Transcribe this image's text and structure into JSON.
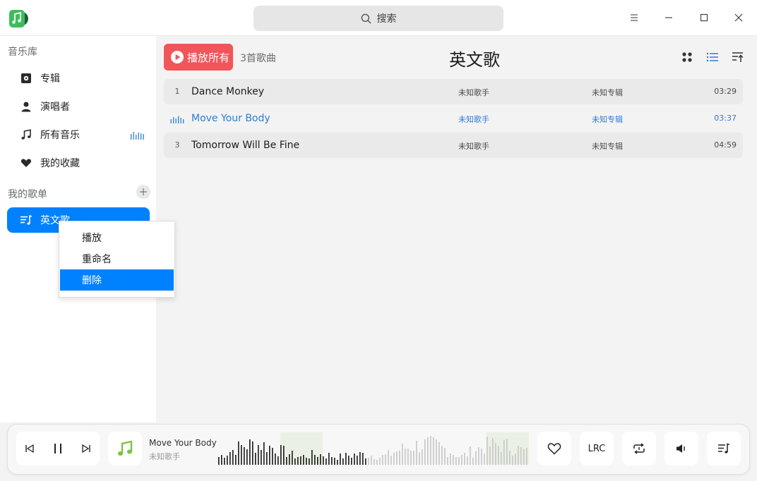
{
  "titlebar": {
    "search_label": "搜索"
  },
  "sidebar": {
    "library_title": "音乐库",
    "items": [
      {
        "label": "专辑",
        "icon": "album-icon"
      },
      {
        "label": "演唱者",
        "icon": "singer-icon"
      },
      {
        "label": "所有音乐",
        "icon": "music-note-icon"
      },
      {
        "label": "我的收藏",
        "icon": "heart-icon"
      }
    ],
    "playlists_title": "我的歌单",
    "playlists": [
      {
        "label": "英文歌",
        "icon": "playlist-icon",
        "active": true
      }
    ]
  },
  "context_menu": {
    "items": [
      {
        "label": "播放",
        "selected": false
      },
      {
        "label": "重命名",
        "selected": false
      },
      {
        "label": "删除",
        "selected": true
      }
    ]
  },
  "main": {
    "play_all_label": "播放所有",
    "song_count": "3首歌曲",
    "title": "英文歌",
    "songs": [
      {
        "num": "1",
        "title": "Dance Monkey",
        "artist": "未知歌手",
        "album": "未知专辑",
        "duration": "03:29",
        "playing": false
      },
      {
        "num": "",
        "title": "Move Your Body",
        "artist": "未知歌手",
        "album": "未知专辑",
        "duration": "03:37",
        "playing": true
      },
      {
        "num": "3",
        "title": "Tomorrow Will Be Fine",
        "artist": "未知歌手",
        "album": "未知专辑",
        "duration": "04:59",
        "playing": false
      }
    ]
  },
  "player": {
    "now_title": "Move Your Body",
    "now_artist": "未知歌手",
    "lrc_label": "LRC",
    "progress": 0.48
  },
  "colors": {
    "accent": "#0081ff",
    "play_all": "#f15559",
    "playing_text": "#2c7cd8",
    "logo_green": "#3dbd5a",
    "cover_green": "#7cc242"
  }
}
